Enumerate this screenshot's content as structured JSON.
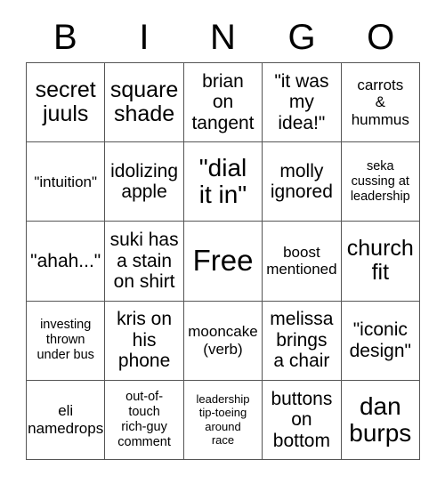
{
  "card": {
    "title": "BINGO",
    "header_letters": [
      "B",
      "I",
      "N",
      "G",
      "O"
    ],
    "rows": [
      [
        {
          "text": "secret\njuuls",
          "size": "fs-lg"
        },
        {
          "text": "square\nshade",
          "size": "fs-lg"
        },
        {
          "text": "brian\non\ntangent",
          "size": "fs-md"
        },
        {
          "text": "\"it was\nmy\nidea!\"",
          "size": "fs-md"
        },
        {
          "text": "carrots\n&\nhummus",
          "size": "fs-sm"
        }
      ],
      [
        {
          "text": "\"intuition\"",
          "size": "fs-sm"
        },
        {
          "text": "idolizing\napple",
          "size": "fs-md"
        },
        {
          "text": "\"dial\nit in\"",
          "size": "fs-xl"
        },
        {
          "text": "molly\nignored",
          "size": "fs-md"
        },
        {
          "text": "seka\ncussing at\nleadership",
          "size": "fs-xs"
        }
      ],
      [
        {
          "text": "\"ahah...\"",
          "size": "fs-md"
        },
        {
          "text": "suki has\na stain\non shirt",
          "size": "fs-md"
        },
        {
          "text": "Free",
          "size": "fs-xxl"
        },
        {
          "text": "boost\nmentioned",
          "size": "fs-sm"
        },
        {
          "text": "church\nfit",
          "size": "fs-lg"
        }
      ],
      [
        {
          "text": "investing\nthrown\nunder bus",
          "size": "fs-xs"
        },
        {
          "text": "kris on\nhis\nphone",
          "size": "fs-md"
        },
        {
          "text": "mooncake\n(verb)",
          "size": "fs-sm"
        },
        {
          "text": "melissa\nbrings\na chair",
          "size": "fs-md"
        },
        {
          "text": "\"iconic\ndesign\"",
          "size": "fs-md"
        }
      ],
      [
        {
          "text": "eli\nnamedrops",
          "size": "fs-sm"
        },
        {
          "text": "out-of-\ntouch\nrich-guy\ncomment",
          "size": "fs-xs"
        },
        {
          "text": "leadership\ntip-toeing\naround\nrace",
          "size": "fs-xxs"
        },
        {
          "text": "buttons\non\nbottom",
          "size": "fs-md"
        },
        {
          "text": "dan\nburps",
          "size": "fs-xl"
        }
      ]
    ]
  },
  "colors": {
    "background": "#ffffff",
    "text": "#000000",
    "grid_line": "#555555"
  }
}
